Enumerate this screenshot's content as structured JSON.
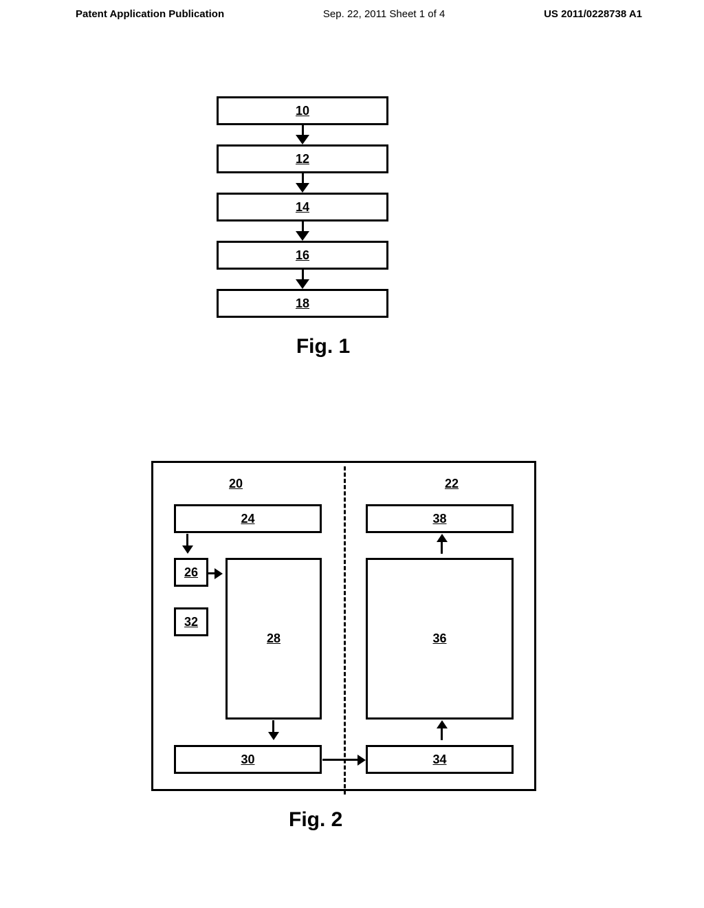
{
  "header": {
    "left": "Patent Application Publication",
    "center": "Sep. 22, 2011  Sheet 1 of 4",
    "right": "US 2011/0228738 A1"
  },
  "fig1": {
    "boxes": [
      "10",
      "12",
      "14",
      "16",
      "18"
    ],
    "label": "Fig. 1"
  },
  "fig2": {
    "label_top_left": "20",
    "label_top_right": "22",
    "box_24": "24",
    "box_38": "38",
    "box_26": "26",
    "box_32": "32",
    "box_28": "28",
    "box_36": "36",
    "box_30": "30",
    "box_34": "34",
    "label": "Fig. 2"
  },
  "chart_data": {
    "type": "diagram",
    "figures": [
      {
        "name": "Fig. 1",
        "type": "flowchart",
        "nodes": [
          "10",
          "12",
          "14",
          "16",
          "18"
        ],
        "edges": [
          {
            "from": "10",
            "to": "12"
          },
          {
            "from": "12",
            "to": "14"
          },
          {
            "from": "14",
            "to": "16"
          },
          {
            "from": "16",
            "to": "18"
          }
        ]
      },
      {
        "name": "Fig. 2",
        "type": "block-diagram",
        "sections": {
          "left": {
            "label": "20",
            "blocks": [
              "24",
              "26",
              "32",
              "28",
              "30"
            ]
          },
          "right": {
            "label": "22",
            "blocks": [
              "38",
              "36",
              "34"
            ]
          }
        },
        "edges": [
          {
            "from": "24",
            "to": "26",
            "direction": "down"
          },
          {
            "from": "26",
            "to": "28",
            "direction": "right"
          },
          {
            "from": "28",
            "to": "30",
            "direction": "down"
          },
          {
            "from": "30",
            "to": "34",
            "direction": "right"
          },
          {
            "from": "34",
            "to": "36",
            "direction": "up"
          },
          {
            "from": "36",
            "to": "38",
            "direction": "up"
          }
        ]
      }
    ]
  }
}
